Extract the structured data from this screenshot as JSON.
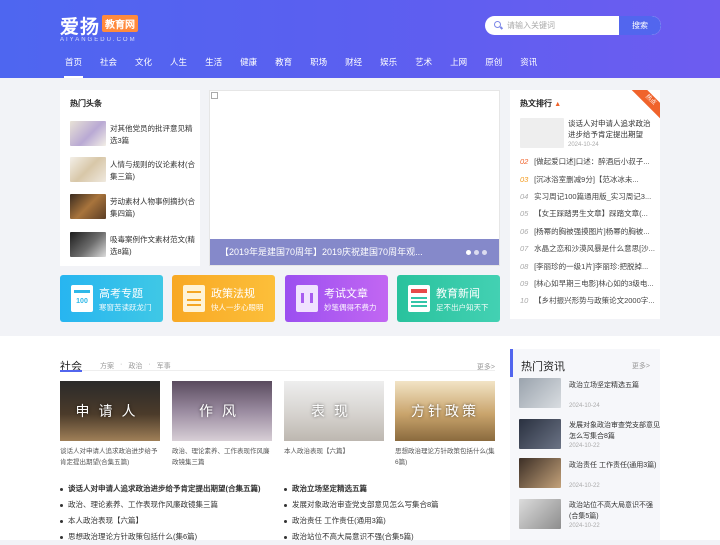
{
  "brand": {
    "name": "爱扬",
    "tag": "教育网",
    "sub": "AIYANGEDU.COM"
  },
  "search": {
    "placeholder": "请输入关键词",
    "button": "搜索"
  },
  "nav": [
    "首页",
    "社会",
    "文化",
    "人生",
    "生活",
    "健康",
    "教育",
    "职场",
    "财经",
    "娱乐",
    "艺术",
    "上网",
    "原创",
    "资讯"
  ],
  "hot_headlines": {
    "title": "热门头条",
    "items": [
      {
        "text": "对其他党员的批评意见精选3篇"
      },
      {
        "text": "人情与规则的议论素材(合集三篇)"
      },
      {
        "text": "劳动素材人物事例摘抄(合集四篇)"
      },
      {
        "text": "吸毒案例作文素材范文(精选8篇)"
      }
    ]
  },
  "slider": {
    "caption": "【2019年是建国70周年】2019庆祝建国70周年观..."
  },
  "ranking": {
    "title": "热文排行",
    "badge": "热点",
    "top": {
      "text": "谈话人对申请人追求政治进步给予肯定提出期望",
      "date": "2024-10-24"
    },
    "rows": [
      {
        "num": "02",
        "text": "[做起爱口述]口述：醉酒后小叔子..."
      },
      {
        "num": "03",
        "text": "[沉冰浴室删减9分]【范冰冰未..."
      },
      {
        "num": "04",
        "text": "实习周记100篇通用版_实习周记3..."
      },
      {
        "num": "05",
        "text": "【女王踩踏男生文章】踩踏文章(..."
      },
      {
        "num": "06",
        "text": "[杨幂的胸被强摸图片]杨幂的胸被..."
      },
      {
        "num": "07",
        "text": "水晶之恋和沙漠风暴是什么意思[沙..."
      },
      {
        "num": "08",
        "text": "[李丽珍的一级1片]李丽珍:把脱掉..."
      },
      {
        "num": "09",
        "text": "[林心如早期三电影]林心如的3级电..."
      },
      {
        "num": "10",
        "text": "【乡村振兴形势与政策论文2000字..."
      }
    ]
  },
  "cards": [
    {
      "title": "高考专题",
      "sub": "寒窗苦读跃龙门",
      "color": "#2eb8e8"
    },
    {
      "title": "政策法规",
      "sub": "快人一步心眼明",
      "color": "#f5a623"
    },
    {
      "title": "考试文章",
      "sub": "妙笔偶得不费力",
      "color": "#a85cf0"
    },
    {
      "title": "教育新闻",
      "sub": "足不出户知天下",
      "color": "#34c5a8"
    }
  ],
  "society": {
    "title": "社会",
    "cats": [
      "方案",
      "政治",
      "军事"
    ],
    "more": "更多>",
    "features": [
      {
        "overlay": "申请人",
        "caption": "谈话人对申请人追求政治进步给予肯定提出期望(合集五篇)"
      },
      {
        "overlay": "作风",
        "caption": "政治、理论素养、工作表现作风廉政镜集三篇"
      },
      {
        "overlay": "表现",
        "caption": "本人政治表现【六篇】"
      },
      {
        "overlay": "方针政策",
        "caption": "思想政治理论方针政策包括什么(集6篇)"
      }
    ],
    "list_left": [
      {
        "text": "谈话人对申请人追求政治进步给予肯定提出期望(合集五篇)",
        "bold": true
      },
      {
        "text": "政治、理论素养、工作表现作风廉政镜集三篇",
        "bold": false
      },
      {
        "text": "本人政治表现【六篇】",
        "bold": false
      },
      {
        "text": "思想政治理论方针政策包括什么(集6篇)",
        "bold": false
      }
    ],
    "list_right": [
      {
        "text": "政治立场坚定精选五篇",
        "bold": true
      },
      {
        "text": "发展对象政治审查党支部意见怎么写集合8篇",
        "bold": false
      },
      {
        "text": "政治责任 工作责任(通用3篇)",
        "bold": false
      },
      {
        "text": "政治站位不高大局意识不强(合集5篇)",
        "bold": false
      }
    ]
  },
  "news": {
    "title": "热门资讯",
    "more": "更多>",
    "items": [
      {
        "text": "政治立场坚定精选五篇",
        "date": "2024-10-24"
      },
      {
        "text": "发展对象政治审查党支部意见怎么写集合8篇",
        "date": "2024-10-22"
      },
      {
        "text": "政治责任 工作责任(通用3篇)",
        "date": "2024-10-22"
      },
      {
        "text": "政治站位不高大局意识不强(合集5篇)",
        "date": "2024-10-22"
      }
    ]
  }
}
